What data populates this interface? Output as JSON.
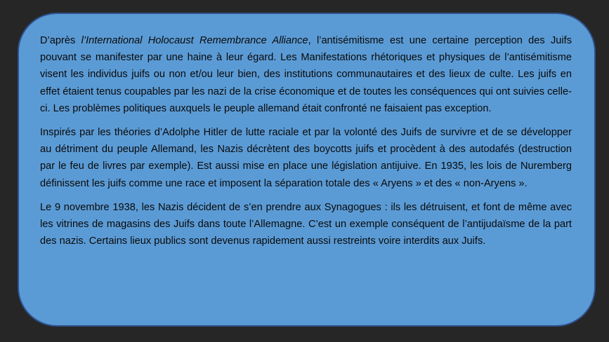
{
  "paragraphs": {
    "p1": {
      "prefix": "D’après ",
      "italic": "l’International Holocaust Remembrance Alliance",
      "rest": ", l’antisémitisme est une certaine perception des Juifs pouvant se manifester par une haine à leur égard. Les Manifestations rhétoriques et physiques de l’antisémitisme visent les individus juifs ou non et/ou leur bien, des institutions communautaires et des lieux de culte. Les juifs en effet étaient tenus coupables par les nazi de la crise économique et de toutes les conséquences qui ont suivies celle-ci. Les problèmes politiques auxquels le peuple allemand était confronté ne faisaient pas exception."
    },
    "p2": "Inspirés par les théories d’Adolphe Hitler de lutte raciale et par la volonté des Juifs de survivre et de se développer au détriment du peuple Allemand, les Nazis décrètent des boycotts juifs et procèdent à des autodafés (destruction par le feu de livres par exemple). Est aussi mise en place une législation antijuive. En 1935, les lois de Nuremberg définissent les juifs comme une race et imposent la séparation totale des « Aryens » et des « non-Aryens ».",
    "p3": "Le 9 novembre 1938, les Nazis décident de s’en prendre aux Synagogues : ils les détruisent, et font de même avec les vitrines de magasins des Juifs dans toute l’Allemagne. C’est un exemple conséquent de l’antijudaïsme de la part des nazis. Certains lieux publics sont devenus rapidement aussi restreints voire interdits aux Juifs."
  },
  "colors": {
    "background": "#262626",
    "panel_fill": "#5b9bd5",
    "panel_border": "#2f528f",
    "text": "#0a0a0a"
  }
}
